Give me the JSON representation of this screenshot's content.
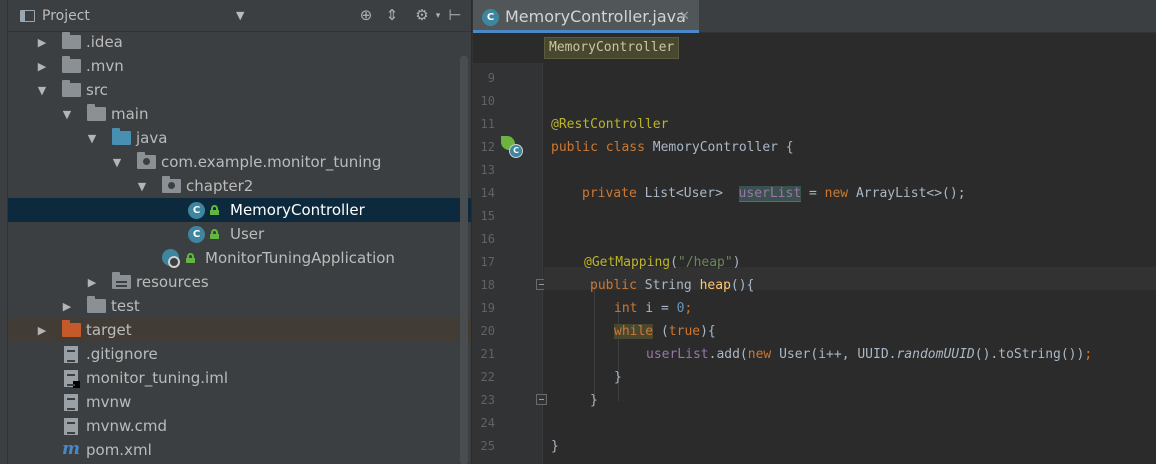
{
  "project_panel": {
    "title": "Project",
    "tree": [
      {
        "label": ".idea"
      },
      {
        "label": ".mvn"
      },
      {
        "label": "src"
      },
      {
        "label": "main"
      },
      {
        "label": "java"
      },
      {
        "label": "com.example.monitor_tuning"
      },
      {
        "label": "chapter2"
      },
      {
        "label": "MemoryController"
      },
      {
        "label": "User"
      },
      {
        "label": "MonitorTuningApplication"
      },
      {
        "label": "resources"
      },
      {
        "label": "test"
      },
      {
        "label": "target"
      },
      {
        "label": ".gitignore"
      },
      {
        "label": "monitor_tuning.iml"
      },
      {
        "label": "mvnw"
      },
      {
        "label": "mvnw.cmd"
      },
      {
        "label": "pom.xml"
      }
    ]
  },
  "editor": {
    "tab_label": "MemoryController.java",
    "breadcrumb": "MemoryController",
    "line_numbers": [
      "9",
      "10",
      "11",
      "12",
      "13",
      "14",
      "15",
      "16",
      "17",
      "18",
      "19",
      "20",
      "21",
      "22",
      "23",
      "24",
      "25"
    ],
    "code": {
      "l11_ann": "@RestController",
      "l12_kw": "public class",
      "l12_rest": " MemoryController {",
      "l14_kw": "private",
      "l14_type": " List<User>  ",
      "l14_field": "userList",
      "l14_eq": " = ",
      "l14_new": "new",
      "l14_rest": " ArrayList<>();",
      "l17_ann": "@GetMapping",
      "l17_open": "(",
      "l17_str": "\"/heap\"",
      "l17_close": ")",
      "l18_kw": "public",
      "l18_type": " String ",
      "l18_fn": "heap",
      "l18_rest": "(){",
      "l19_kw": "int",
      "l19_mid": " i = ",
      "l19_num": "0",
      "l19_end": ";",
      "l20_while": "while",
      "l20_sp": " (",
      "l20_true": "true",
      "l20_rest": "){",
      "l21_field": "userList",
      "l21_add": ".add(",
      "l21_new": "new",
      "l21_user": " User(i++, UUID.",
      "l21_ital": "randomUUID",
      "l21_tail": "().toString())",
      "l21_semi": ";",
      "l22": "}",
      "l23": "}",
      "l25": "}"
    }
  }
}
